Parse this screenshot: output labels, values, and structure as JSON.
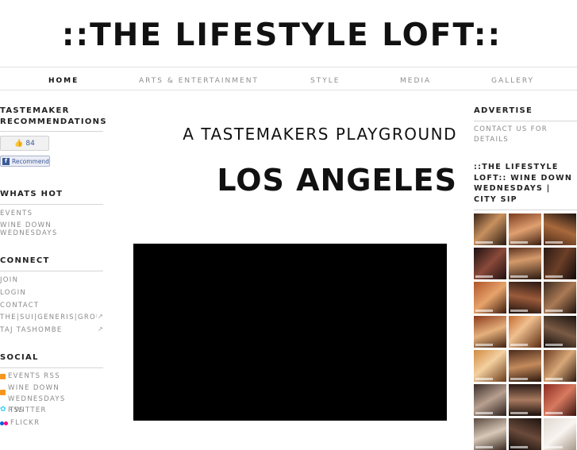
{
  "site": {
    "title": "::THE LIFESTYLE LOFT::"
  },
  "nav": [
    {
      "label": "HOME",
      "active": true
    },
    {
      "label": "ARTS & ENTERTAINMENT",
      "active": false
    },
    {
      "label": "STYLE",
      "active": false
    },
    {
      "label": "MEDIA",
      "active": false
    },
    {
      "label": "GALLERY",
      "active": false
    }
  ],
  "left": {
    "tastemaker": {
      "heading": "TASTEMAKER RECOMMENDATIONS",
      "like_count": "84",
      "recommend_label": "Recommend"
    },
    "whats_hot": {
      "heading": "WHATS HOT",
      "links": [
        "EVENTS",
        "WINE DOWN WEDNESDAYS"
      ]
    },
    "connect": {
      "heading": "CONNECT",
      "links": [
        "JOIN",
        "LOGIN",
        "CONTACT",
        "THE|SUI|GENERIS|GROUP",
        "TAJ TASHOMBE"
      ]
    },
    "social": {
      "heading": "SOCIAL",
      "links": [
        "EVENTS RSS",
        "WINE DOWN WEDNESDAYS RSS",
        "TWITTER",
        "FLICKR"
      ]
    }
  },
  "main": {
    "tagline": "A TASTEMAKERS PLAYGROUND",
    "city": "LOS ANGELES"
  },
  "right": {
    "advertise": {
      "heading": "ADVERTISE",
      "text": "CONTACT US FOR DETAILS"
    },
    "gallery": {
      "heading": "::THE LIFESTYLE LOFT:: WINE DOWN WEDNESDAYS | CITY SIP"
    }
  },
  "colors": {
    "nav_inactive": "#8d8d8d",
    "video_bg": "#000000",
    "rss": "#f7961d",
    "facebook": "#3b5998"
  }
}
